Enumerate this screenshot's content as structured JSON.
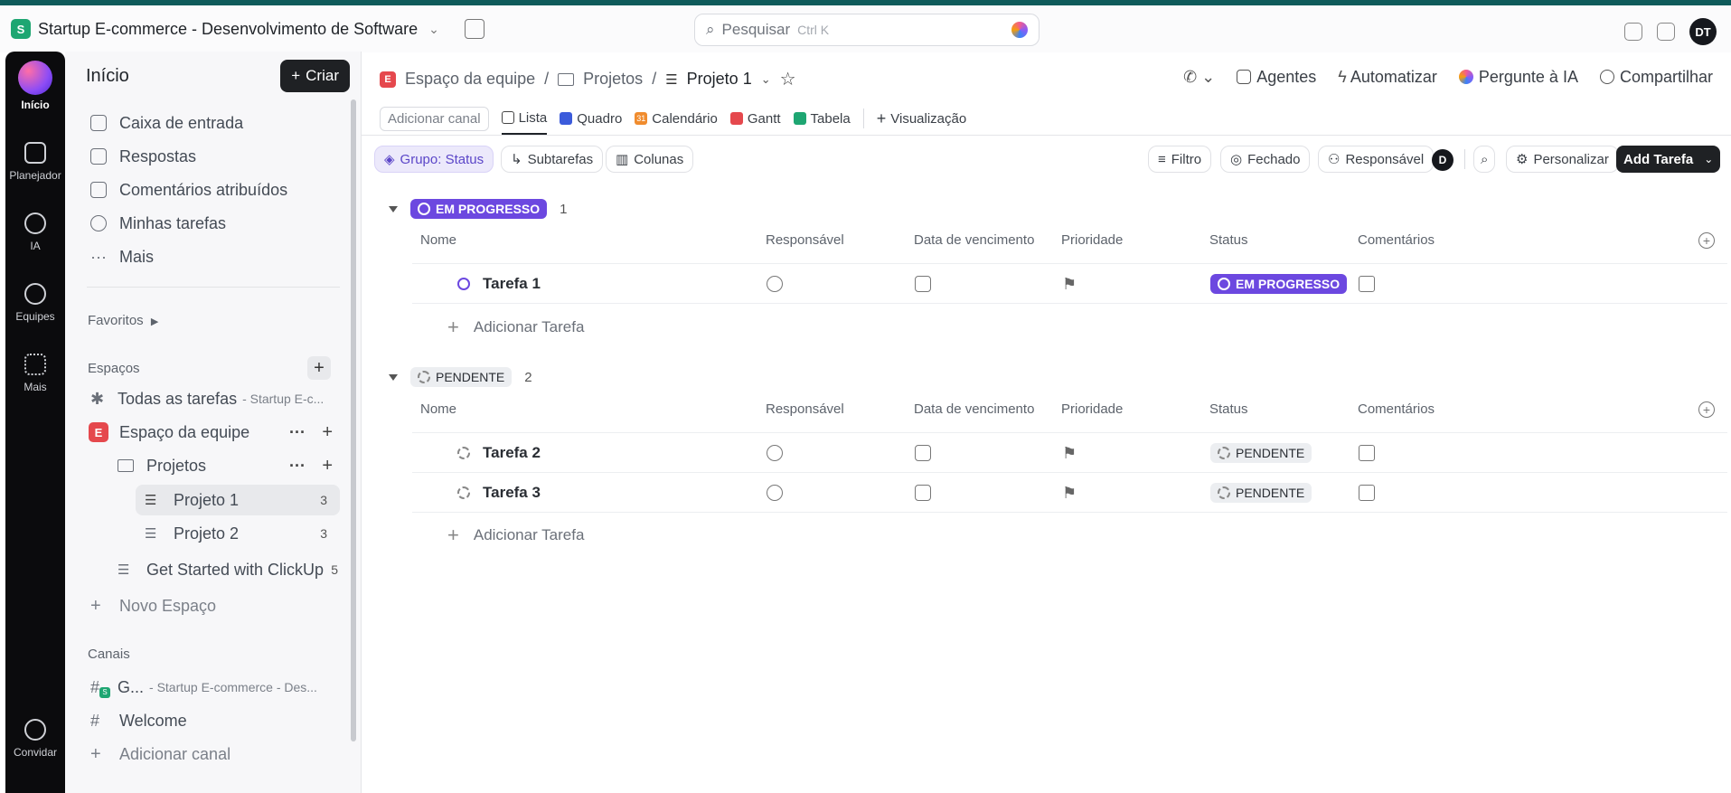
{
  "topbar": {
    "workspace_badge": "S",
    "workspace_name": "Startup E-commerce - Desenvolvimento de Software",
    "search_placeholder": "Pesquisar",
    "search_shortcut": "Ctrl K",
    "avatar_initials": "DT"
  },
  "rail": {
    "items": [
      "Início",
      "Planejador",
      "IA",
      "Equipes",
      "Mais",
      "Convidar"
    ]
  },
  "sidebar": {
    "title": "Início",
    "create_label": "Criar",
    "nav": [
      "Caixa de entrada",
      "Respostas",
      "Comentários atribuídos",
      "Minhas tarefas",
      "Mais"
    ],
    "favorites_label": "Favoritos",
    "spaces_label": "Espaços",
    "all_tasks": "Todas as tarefas",
    "all_tasks_suffix": "- Startup E-c...",
    "space_badge": "E",
    "space_name": "Espaço da equipe",
    "folder_name": "Projetos",
    "projects": [
      {
        "name": "Projeto 1",
        "count": "3"
      },
      {
        "name": "Projeto 2",
        "count": "3"
      }
    ],
    "get_started": {
      "name": "Get Started with ClickUp",
      "count": "5"
    },
    "new_space": "Novo Espaço",
    "channels_label": "Canais",
    "channel_1": "G...",
    "channel_1_suffix": "- Startup E-commerce - Des...",
    "channel_1_badge": "S",
    "channel_2": "Welcome",
    "add_channel": "Adicionar canal"
  },
  "breadcrumb": {
    "space_badge": "E",
    "space": "Espaço da equipe",
    "sep": "/",
    "folder": "Projetos",
    "current": "Projeto 1"
  },
  "header_actions": [
    "Agentes",
    "Automatizar",
    "Pergunte à IA",
    "Compartilhar"
  ],
  "views": {
    "add_channel": "Adicionar canal",
    "tabs": [
      "Lista",
      "Quadro",
      "Calendário",
      "Gantt",
      "Tabela"
    ],
    "add_view": "Visualização",
    "calendar_day": "31"
  },
  "toolbar": {
    "group": "Grupo: Status",
    "subtasks": "Subtarefas",
    "columns": "Colunas",
    "filter": "Filtro",
    "closed": "Fechado",
    "assignee": "Responsável",
    "me_initial": "D",
    "customize": "Personalizar",
    "add_task": "Add Tarefa"
  },
  "columns": [
    "Nome",
    "Responsável",
    "Data de vencimento",
    "Prioridade",
    "Status",
    "Comentários"
  ],
  "groups": [
    {
      "status": "EM PROGRESSO",
      "count": "1",
      "tasks": [
        {
          "name": "Tarefa 1",
          "status": "EM PROGRESSO"
        }
      ],
      "add_label": "Adicionar Tarefa"
    },
    {
      "status": "PENDENTE",
      "count": "2",
      "tasks": [
        {
          "name": "Tarefa 2",
          "status": "PENDENTE"
        },
        {
          "name": "Tarefa 3",
          "status": "PENDENTE"
        }
      ],
      "add_label": "Adicionar Tarefa"
    }
  ],
  "colors": {
    "in_progress": "#6c48e0",
    "accent_dark": "#1f2124",
    "space_red": "#e5484d",
    "workspace_green": "#1ea672"
  }
}
